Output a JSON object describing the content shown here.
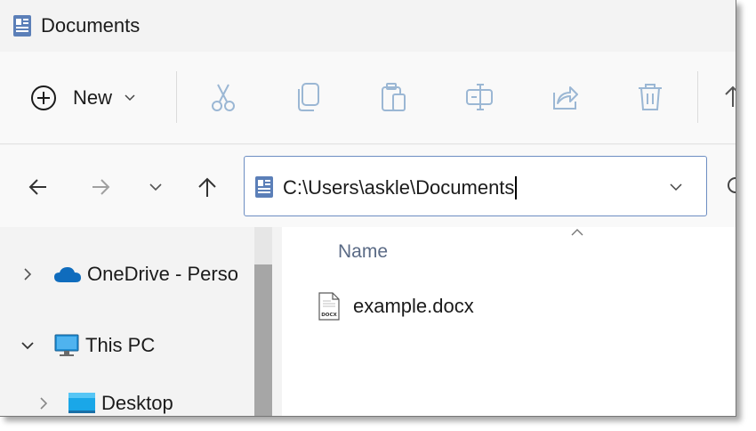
{
  "window": {
    "title": "Documents"
  },
  "command_bar": {
    "new_label": "New",
    "icons": [
      "cut-icon",
      "copy-icon",
      "paste-icon",
      "rename-icon",
      "share-icon",
      "delete-icon"
    ]
  },
  "address_bar": {
    "path": "C:\\Users\\askle\\Documents"
  },
  "nav_pane": {
    "items": [
      {
        "label": "OneDrive - Perso",
        "expanded": false
      },
      {
        "label": "This PC",
        "expanded": true
      },
      {
        "label": "Desktop",
        "expanded": false
      }
    ]
  },
  "file_list": {
    "column_name": "Name",
    "sort": "ascending",
    "files": [
      {
        "name": "example.docx",
        "icon": "docx-file-icon",
        "icon_badge": "DOCX"
      }
    ]
  },
  "colors": {
    "window_bg": "#f3f3f3",
    "address_border": "#6d8ec2",
    "icon_disabled": "#9bb7d4",
    "column_header": "#5a6a85"
  }
}
